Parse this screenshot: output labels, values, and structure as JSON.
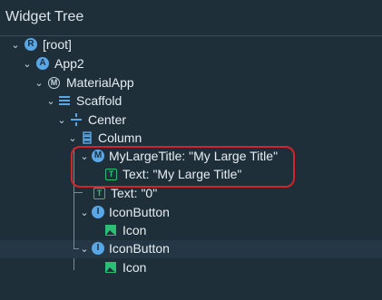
{
  "panel": {
    "title": "Widget Tree"
  },
  "nodes": [
    {
      "label": "[root]",
      "badge": "R"
    },
    {
      "label": "App2",
      "badge": "A"
    },
    {
      "label": "MaterialApp",
      "badge": "M"
    },
    {
      "label": "Scaffold"
    },
    {
      "label": "Center"
    },
    {
      "label": "Column"
    },
    {
      "label": "MyLargeTitle: \"My Large Title\"",
      "badge": "M"
    },
    {
      "label": "Text: \"My Large Title\"",
      "badge": "T"
    },
    {
      "label": "Text: \"0\"",
      "badge": "T"
    },
    {
      "label": "IconButton",
      "badge": "I"
    },
    {
      "label": "Icon"
    },
    {
      "label": "IconButton",
      "badge": "I"
    },
    {
      "label": "Icon"
    }
  ],
  "icons": {
    "root": "flutter-widget-icon",
    "app": "flutter-widget-icon",
    "materialapp": "material-app-icon",
    "scaffold": "scaffold-layout-icon",
    "center": "center-align-icon",
    "column": "column-layout-icon",
    "text": "text-widget-icon",
    "image": "image-icon"
  },
  "colors": {
    "background": "#1f2f3a",
    "accent_blue": "#59a7e6",
    "green": "#2cbf74",
    "highlight_outline": "#d2242a"
  }
}
